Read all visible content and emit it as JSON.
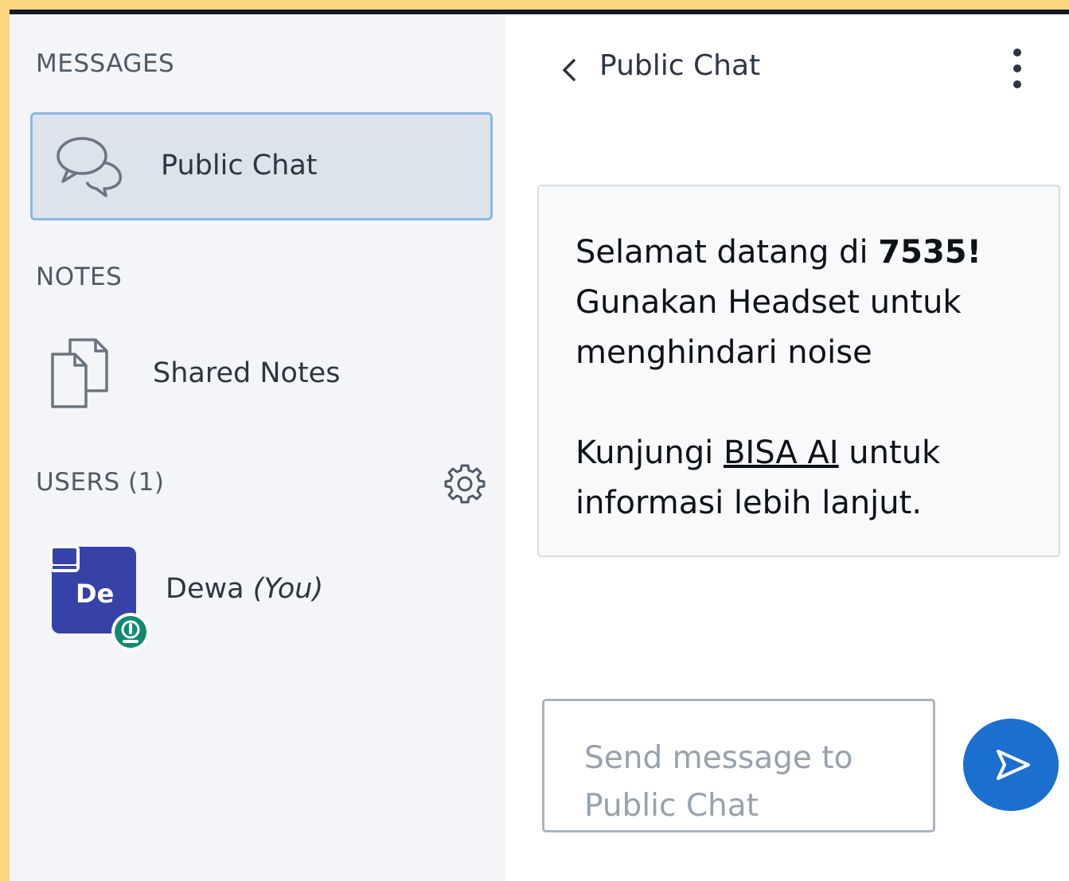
{
  "sidebar": {
    "messages_title": "MESSAGES",
    "public_chat_label": "Public Chat",
    "notes_title": "NOTES",
    "shared_notes_label": "Shared Notes",
    "users_title": "USERS (1)",
    "user": {
      "initials": "De",
      "name": "Dewa",
      "you_label": "(You)",
      "avatar_color": "#3543a8",
      "voice_badge_color": "#0f8a6e"
    }
  },
  "chat": {
    "title": "Public Chat",
    "welcome": {
      "line1_prefix": "Selamat datang di ",
      "line1_bold": "7535!",
      "line2": "Gunakan Headset untuk menghindari noise",
      "line3_prefix": "Kunjungi ",
      "line3_link": "BISA AI",
      "line3_suffix": " untuk informasi lebih lanjut."
    },
    "input_placeholder": "Send message to Public Chat",
    "send_button_color": "#1b6fcf"
  },
  "theme": {
    "frame_color": "#fdd581",
    "sidebar_bg": "#f3f5f8",
    "selected_item_bg": "#dde3eb",
    "selected_item_border": "#8bb8e6"
  }
}
